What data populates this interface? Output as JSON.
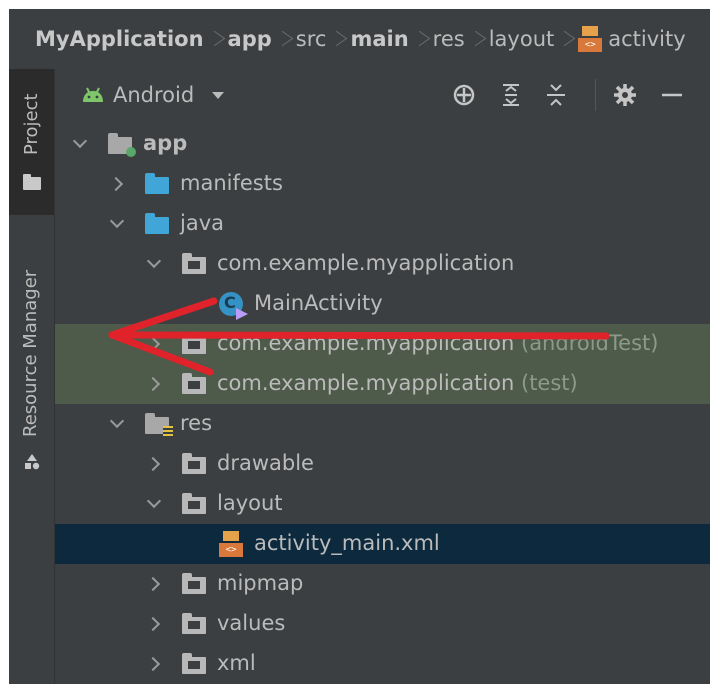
{
  "breadcrumb": [
    {
      "label": "MyApplication",
      "bold": true
    },
    {
      "label": "app",
      "bold": true
    },
    {
      "label": "src",
      "bold": false
    },
    {
      "label": "main",
      "bold": true
    },
    {
      "label": "res",
      "bold": false
    },
    {
      "label": "layout",
      "bold": false
    },
    {
      "label": "activity",
      "bold": false,
      "icon": "xml-file-icon"
    }
  ],
  "sidebar": {
    "project_label": "Project",
    "resource_manager_label": "Resource Manager"
  },
  "toolbar": {
    "view_label": "Android",
    "buttons": [
      "crosshair-icon",
      "expand-all-icon",
      "collapse-all-icon",
      "gear-icon",
      "minimize-icon"
    ]
  },
  "tree": [
    {
      "label": "app",
      "bold": true,
      "suffix": "",
      "depth": 0,
      "chevron": "down",
      "icon": "app-module-folder-icon",
      "state": ""
    },
    {
      "label": "manifests",
      "bold": false,
      "suffix": "",
      "depth": 1,
      "chevron": "right",
      "icon": "blue-folder-icon",
      "state": ""
    },
    {
      "label": "java",
      "bold": false,
      "suffix": "",
      "depth": 1,
      "chevron": "down",
      "icon": "blue-folder-icon",
      "state": ""
    },
    {
      "label": "com.example.myapplication",
      "bold": false,
      "suffix": "",
      "depth": 2,
      "chevron": "down",
      "icon": "package-folder-icon",
      "state": ""
    },
    {
      "label": "MainActivity",
      "bold": false,
      "suffix": "",
      "depth": 3,
      "chevron": "",
      "icon": "class-icon",
      "state": ""
    },
    {
      "label": "com.example.myapplication",
      "bold": false,
      "suffix": "(androidTest)",
      "depth": 2,
      "chevron": "right",
      "icon": "package-folder-icon",
      "state": "highlight"
    },
    {
      "label": "com.example.myapplication",
      "bold": false,
      "suffix": "(test)",
      "depth": 2,
      "chevron": "right",
      "icon": "package-folder-icon",
      "state": "highlight"
    },
    {
      "label": "res",
      "bold": false,
      "suffix": "",
      "depth": 1,
      "chevron": "down",
      "icon": "resource-folder-icon",
      "state": ""
    },
    {
      "label": "drawable",
      "bold": false,
      "suffix": "",
      "depth": 2,
      "chevron": "right",
      "icon": "package-folder-icon",
      "state": ""
    },
    {
      "label": "layout",
      "bold": false,
      "suffix": "",
      "depth": 2,
      "chevron": "down",
      "icon": "package-folder-icon",
      "state": ""
    },
    {
      "label": "activity_main.xml",
      "bold": false,
      "suffix": "",
      "depth": 3,
      "chevron": "",
      "icon": "xml-file-icon",
      "state": "selected"
    },
    {
      "label": "mipmap",
      "bold": false,
      "suffix": "",
      "depth": 2,
      "chevron": "right",
      "icon": "package-folder-icon",
      "state": ""
    },
    {
      "label": "values",
      "bold": false,
      "suffix": "",
      "depth": 2,
      "chevron": "right",
      "icon": "package-folder-icon",
      "state": ""
    },
    {
      "label": "xml",
      "bold": false,
      "suffix": "",
      "depth": 2,
      "chevron": "right",
      "icon": "package-folder-icon",
      "state": ""
    }
  ],
  "annotation": {
    "color": "#e0232a",
    "icon": "red-arrow-annotation"
  }
}
